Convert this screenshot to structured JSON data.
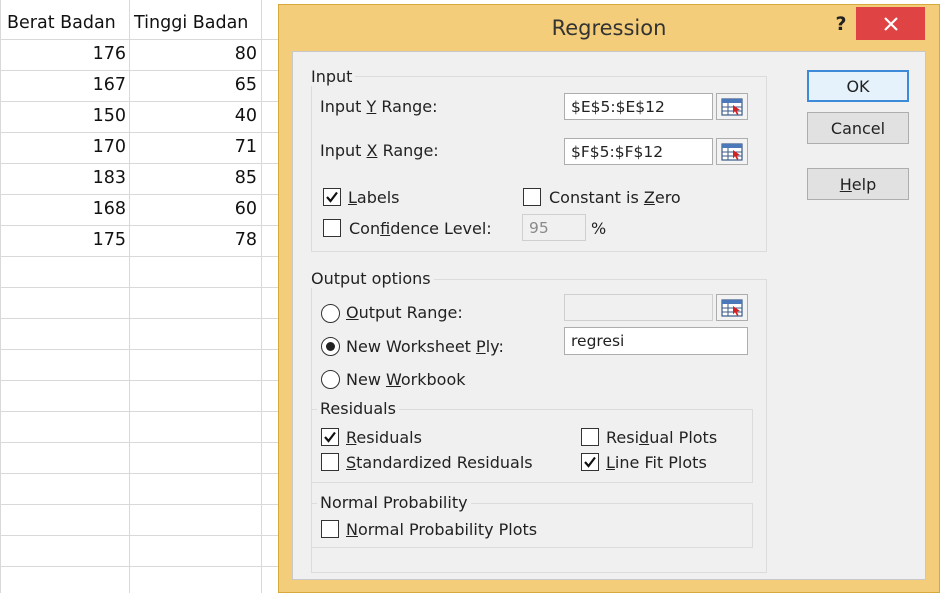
{
  "sheet": {
    "headers": [
      "Berat Badan",
      "Tinggi Badan"
    ],
    "rows": [
      [
        "176",
        "80"
      ],
      [
        "167",
        "65"
      ],
      [
        "150",
        "40"
      ],
      [
        "170",
        "71"
      ],
      [
        "183",
        "85"
      ],
      [
        "168",
        "60"
      ],
      [
        "175",
        "78"
      ]
    ]
  },
  "dialog": {
    "title": "Regression",
    "help_glyph": "?",
    "input_group": "Input",
    "input_y_label": {
      "pre": "Input ",
      "key": "Y",
      "post": " Range:"
    },
    "input_y_value": "$E$5:$E$12",
    "input_x_label": {
      "pre": "Input ",
      "key": "X",
      "post": " Range:"
    },
    "input_x_value": "$F$5:$F$12",
    "labels": {
      "pre": "",
      "key": "L",
      "post": "abels",
      "checked": true
    },
    "constant_zero": {
      "pre": "Constant is ",
      "key": "Z",
      "post": "ero",
      "checked": false
    },
    "confidence": {
      "pre": "Con",
      "key": "f",
      "post": "idence Level:",
      "checked": false
    },
    "confidence_value": "95",
    "percent": "%",
    "output_group": "Output options",
    "output_range": {
      "pre": "",
      "key": "O",
      "post": "utput Range:",
      "selected": false
    },
    "output_range_value": "",
    "new_worksheet": {
      "pre": "New Worksheet ",
      "key": "P",
      "post": "ly:",
      "selected": true
    },
    "new_worksheet_value": "regresi",
    "new_workbook": {
      "pre": "New ",
      "key": "W",
      "post": "orkbook",
      "selected": false
    },
    "residuals_group": "Residuals",
    "residuals": {
      "pre": "",
      "key": "R",
      "post": "esiduals",
      "checked": true
    },
    "standardized": {
      "pre": "",
      "key": "S",
      "post": "tandardized Residuals",
      "checked": false
    },
    "residual_plots": {
      "pre": "Resi",
      "key": "d",
      "post": "ual Plots",
      "checked": false
    },
    "line_fit": {
      "pre": "",
      "key": "L",
      "post": "ine Fit Plots",
      "checked": true
    },
    "normal_group": "Normal Probability",
    "normal_plots": {
      "pre": "",
      "key": "N",
      "post": "ormal Probability Plots",
      "checked": false
    },
    "ok": "OK",
    "cancel": "Cancel",
    "help": {
      "pre": "",
      "key": "H",
      "post": "elp"
    }
  },
  "colors": {
    "dialog_frame": "#f4cd7a",
    "close_button": "#e04343",
    "default_button_border": "#3c8ad8"
  }
}
